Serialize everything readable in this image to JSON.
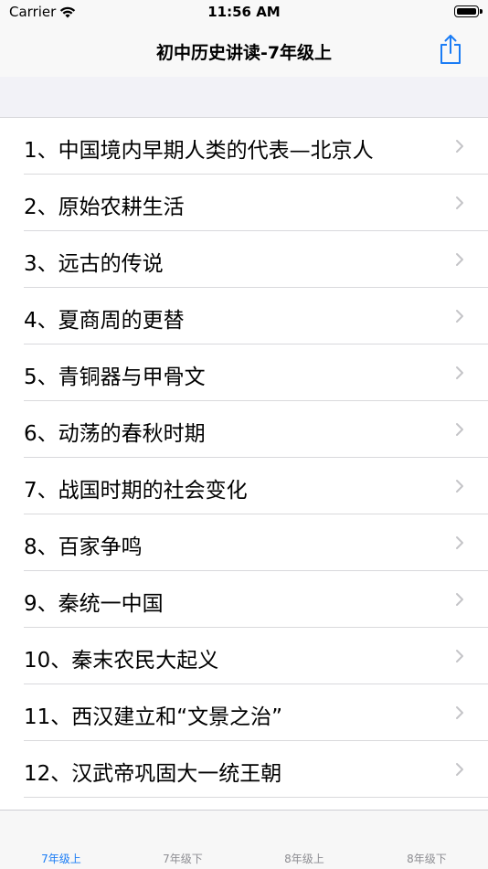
{
  "status_bar": {
    "carrier": "Carrier",
    "time": "11:56 AM"
  },
  "nav": {
    "title": "初中历史讲读-7年级上",
    "share_icon": "share-icon"
  },
  "colors": {
    "accent": "#1a7cf5",
    "chevron": "#c4c4c7"
  },
  "list": {
    "items": [
      {
        "label": "1、中国境内早期人类的代表—北京人"
      },
      {
        "label": "2、原始农耕生活"
      },
      {
        "label": "3、远古的传说"
      },
      {
        "label": "4、夏商周的更替"
      },
      {
        "label": "5、青铜器与甲骨文"
      },
      {
        "label": "6、动荡的春秋时期"
      },
      {
        "label": "7、战国时期的社会变化"
      },
      {
        "label": "8、百家争鸣"
      },
      {
        "label": "9、秦统一中国"
      },
      {
        "label": "10、秦末农民大起义"
      },
      {
        "label": "11、西汉建立和“文景之治”"
      },
      {
        "label": "12、汉武帝巩固大一统王朝"
      }
    ]
  },
  "tabs": [
    {
      "label": "7年级上"
    },
    {
      "label": "7年级下"
    },
    {
      "label": "8年级上"
    },
    {
      "label": "8年级下"
    }
  ]
}
